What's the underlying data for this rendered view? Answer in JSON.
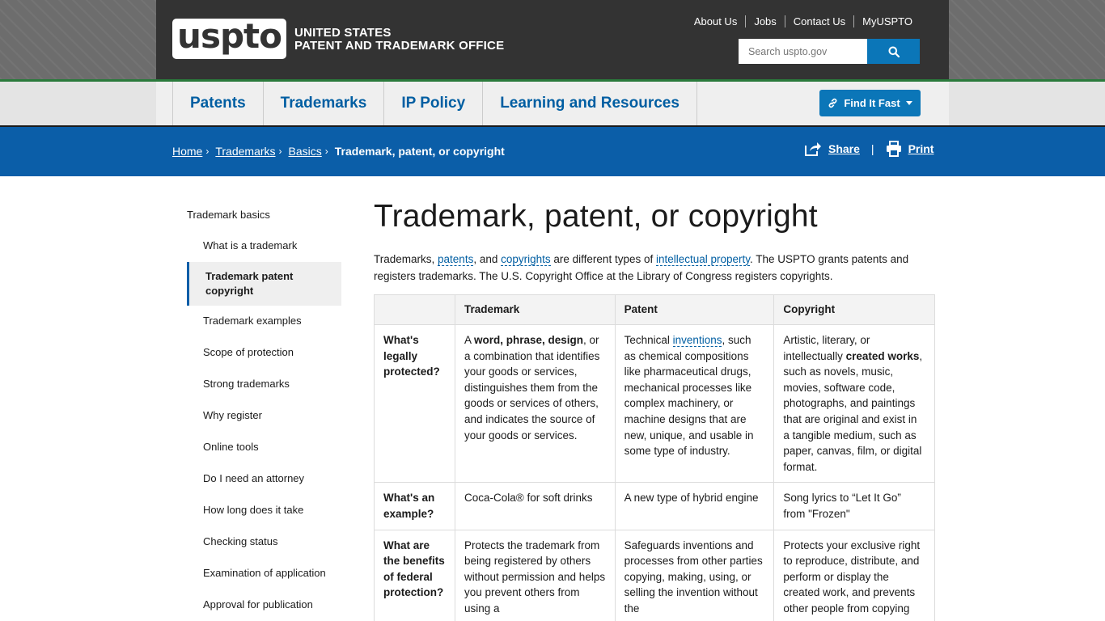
{
  "header": {
    "logo_text": "uspto",
    "agency_line1": "UNITED STATES",
    "agency_line2": "PATENT AND TRADEMARK OFFICE",
    "util_links": [
      "About Us",
      "Jobs",
      "Contact Us",
      "MyUSPTO"
    ],
    "search_placeholder": "Search uspto.gov"
  },
  "nav": {
    "items": [
      "Patents",
      "Trademarks",
      "IP Policy",
      "Learning and Resources"
    ],
    "find_it_fast": "Find It Fast"
  },
  "breadcrumb": {
    "links": [
      "Home",
      "Trademarks",
      "Basics"
    ],
    "current": "Trademark, patent, or copyright",
    "share": "Share",
    "print": "Print"
  },
  "sidebar": {
    "heading": "Trademark basics",
    "items": [
      "What is a trademark",
      "Trademark patent copyright",
      "Trademark examples",
      "Scope of protection",
      "Strong trademarks",
      "Why register",
      "Online tools",
      "Do I need an attorney",
      "How long does it take",
      "Checking status",
      "Examination of application",
      "Approval for publication"
    ]
  },
  "main": {
    "title": "Trademark, patent, or copyright",
    "intro": {
      "p1": "Trademarks, ",
      "l1": "patents",
      "p2": ", and ",
      "l2": "copyrights",
      "p3": " are different types of ",
      "l3": "intellectual property",
      "p4": ". The USPTO grants patents and registers trademarks. The U.S. Copyright Office at the Library of Congress registers copyrights."
    },
    "table": {
      "headers": [
        "",
        "Trademark",
        "Patent",
        "Copyright"
      ],
      "row1": {
        "label": "What's legally protected?",
        "tm_a": "A ",
        "tm_b": "word, phrase, design",
        "tm_c": ", or a combination that identifies your goods or services, distinguishes them from the goods or services of others, and indicates the source of your goods or services.",
        "pat_a": "Technical ",
        "pat_link": "inventions",
        "pat_b": ", such as chemical compositions like pharmaceutical drugs, mechanical processes like complex machinery, or machine designs that are new, unique, and usable in some type of industry.",
        "cr_a": "Artistic, literary, or intellectually ",
        "cr_b": "created works",
        "cr_c": ", such as novels, music, movies, software code, photographs, and paintings that are original and exist in a tangible medium, such as paper, canvas, film, or digital format."
      },
      "row2": {
        "label": "What's an example?",
        "tm": "Coca-Cola® for soft drinks",
        "pat": "A new type of hybrid engine",
        "cr": "Song lyrics to “Let It Go” from \"Frozen\""
      },
      "row3": {
        "label": "What are the benefits of federal protection?",
        "tm": "Protects the trademark from being registered by others without permission and helps you prevent others from using a",
        "pat": "Safeguards inventions and processes from other parties copying, making, using, or selling the invention without the",
        "cr": "Protects your exclusive right to reproduce, distribute, and perform or display the created work, and prevents other people from copying"
      }
    }
  }
}
